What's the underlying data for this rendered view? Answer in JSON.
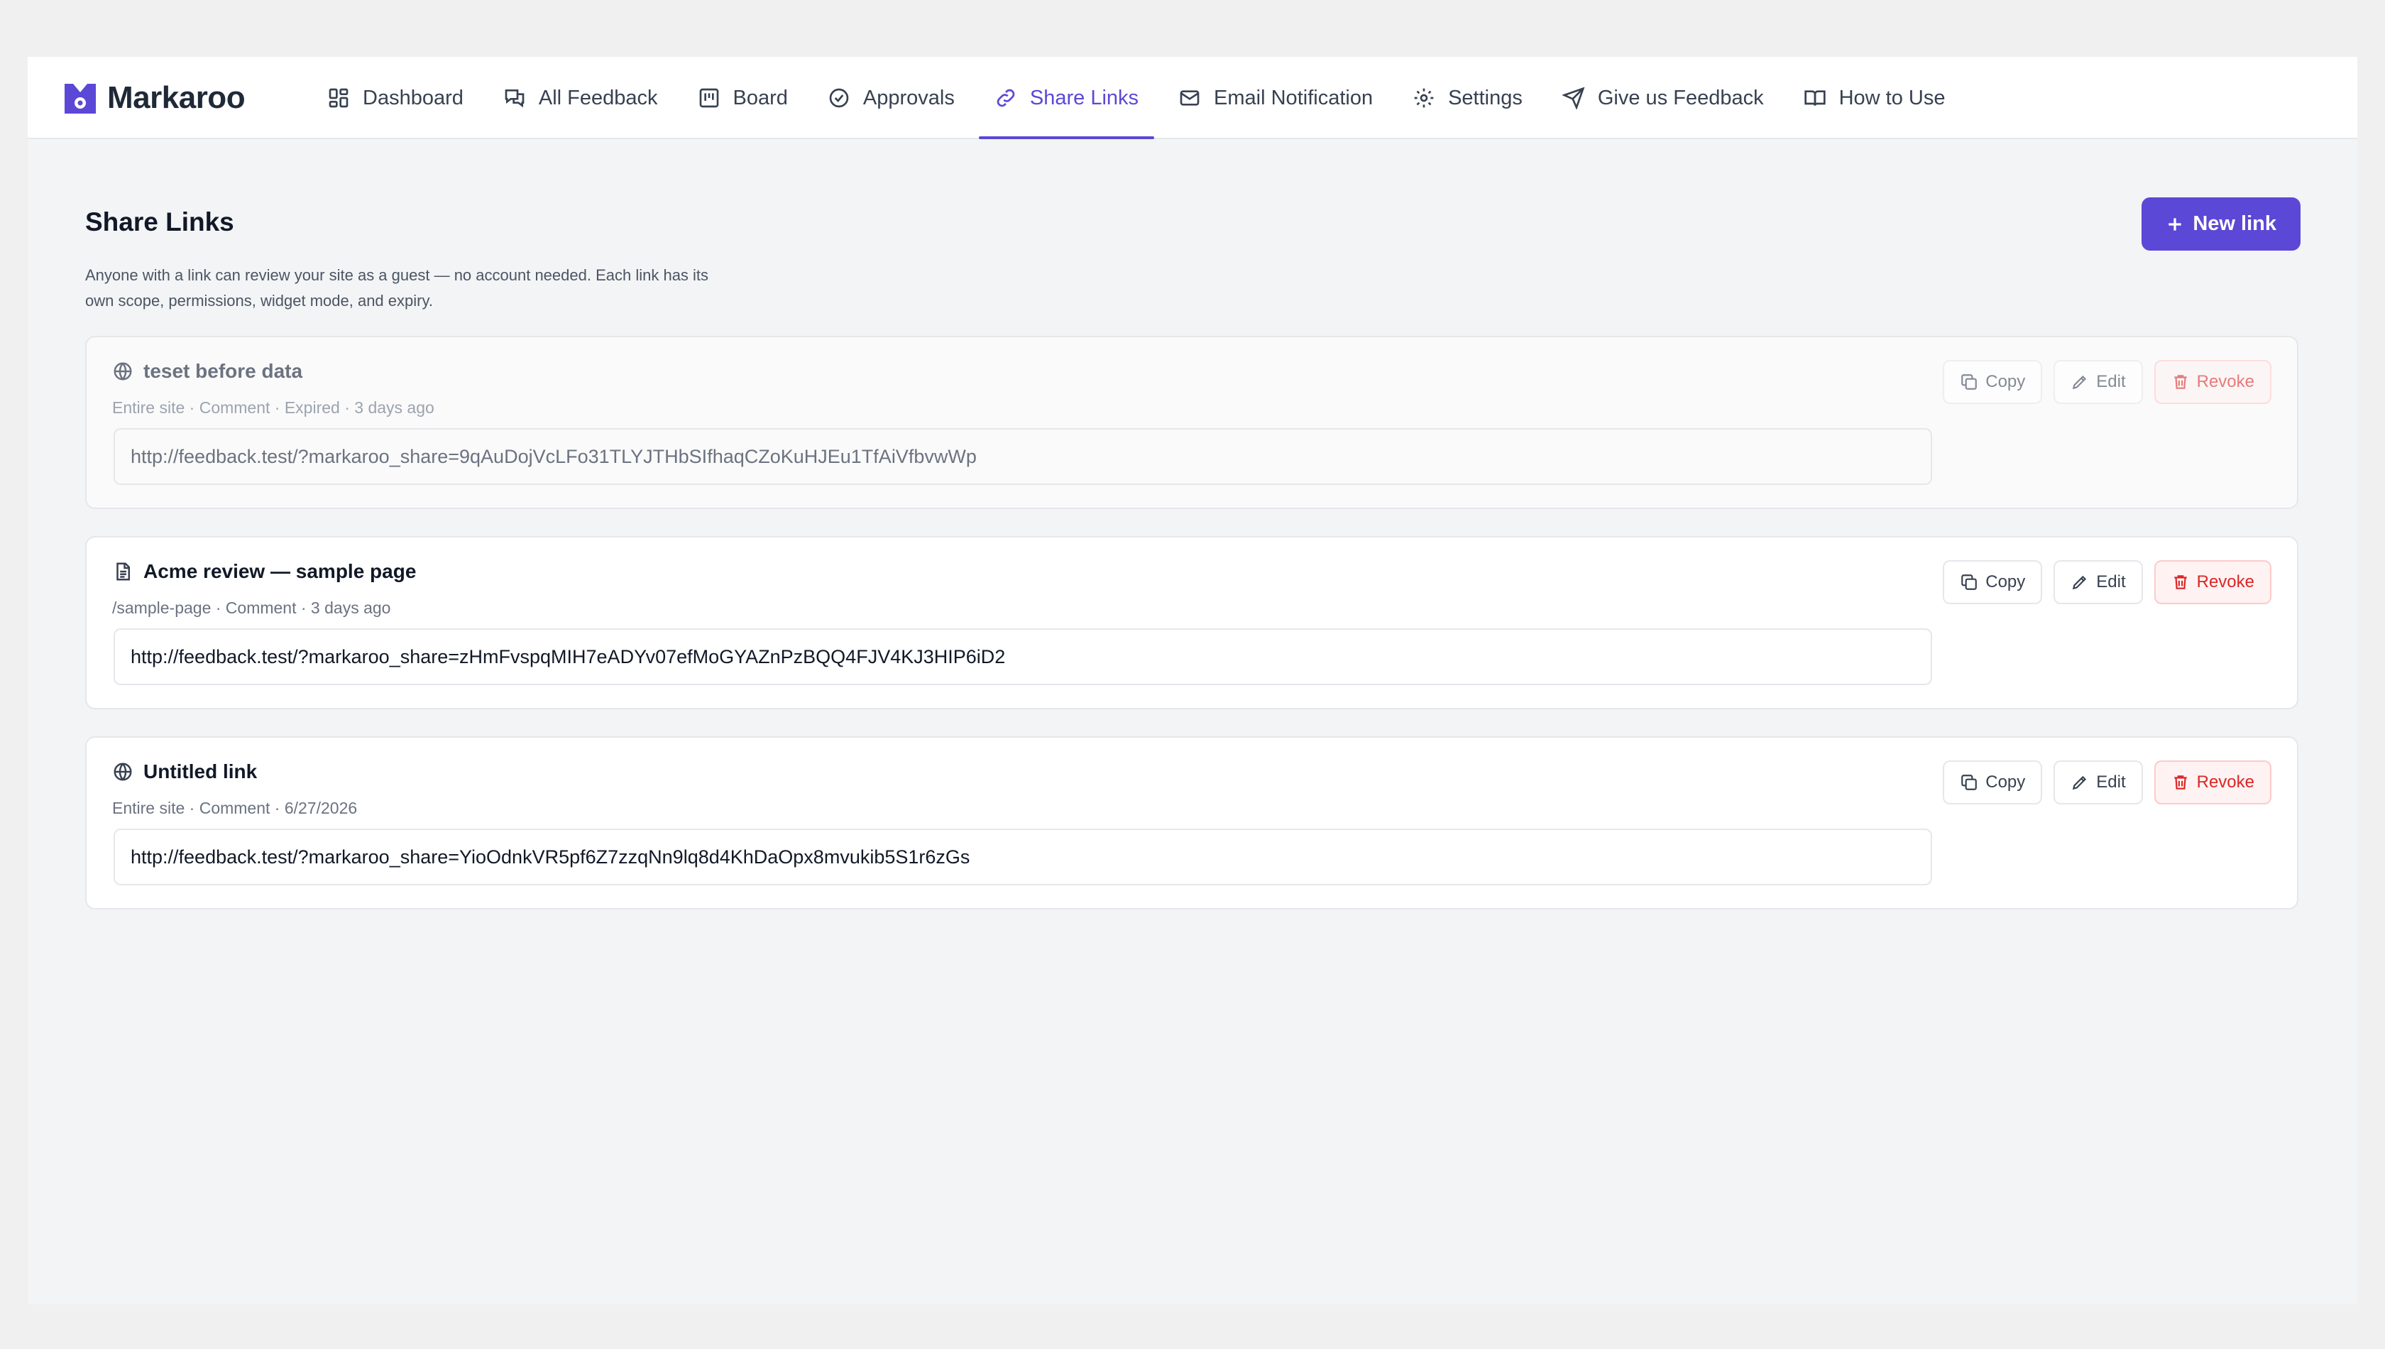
{
  "app": {
    "name": "Markaroo",
    "accent": "#5b48d6"
  },
  "nav": {
    "items": [
      {
        "label": "Dashboard",
        "icon": "dashboard-icon",
        "active": false
      },
      {
        "label": "All Feedback",
        "icon": "chat-bubbles-icon",
        "active": false
      },
      {
        "label": "Board",
        "icon": "board-icon",
        "active": false
      },
      {
        "label": "Approvals",
        "icon": "check-circle-icon",
        "active": false
      },
      {
        "label": "Share Links",
        "icon": "link-icon",
        "active": true
      },
      {
        "label": "Email Notification",
        "icon": "mail-icon",
        "active": false
      },
      {
        "label": "Settings",
        "icon": "gear-icon",
        "active": false
      },
      {
        "label": "Give us Feedback",
        "icon": "send-icon",
        "active": false
      },
      {
        "label": "How to Use",
        "icon": "book-icon",
        "active": false
      }
    ]
  },
  "page": {
    "title": "Share Links",
    "description_line1": "Anyone with a link can review your site as a guest — no account needed. Each link has its",
    "description_line2": "own scope, permissions, widget mode, and expiry.",
    "new_link_label": "New link"
  },
  "actions": {
    "copy": "Copy",
    "edit": "Edit",
    "revoke": "Revoke"
  },
  "links": [
    {
      "title": "teset before data",
      "icon": "globe-icon",
      "meta": "Entire site · Comment · Expired · 3 days ago",
      "url": "http://feedback.test/?markaroo_share=9qAuDojVcLFo31TLYJTHbSIfhaqCZoKuHJEu1TfAiVfbvwWp",
      "expired": true
    },
    {
      "title": "Acme review — sample page",
      "icon": "document-icon",
      "meta": "/sample-page · Comment · 3 days ago",
      "url": "http://feedback.test/?markaroo_share=zHmFvspqMIH7eADYv07efMoGYAZnPzBQQ4FJV4KJ3HIP6iD2",
      "expired": false
    },
    {
      "title": "Untitled link",
      "icon": "globe-icon",
      "meta": "Entire site · Comment · 6/27/2026",
      "url": "http://feedback.test/?markaroo_share=YioOdnkVR5pf6Z7zzqNn9lq8d4KhDaOpx8mvukib5S1r6zGs",
      "expired": false
    }
  ]
}
